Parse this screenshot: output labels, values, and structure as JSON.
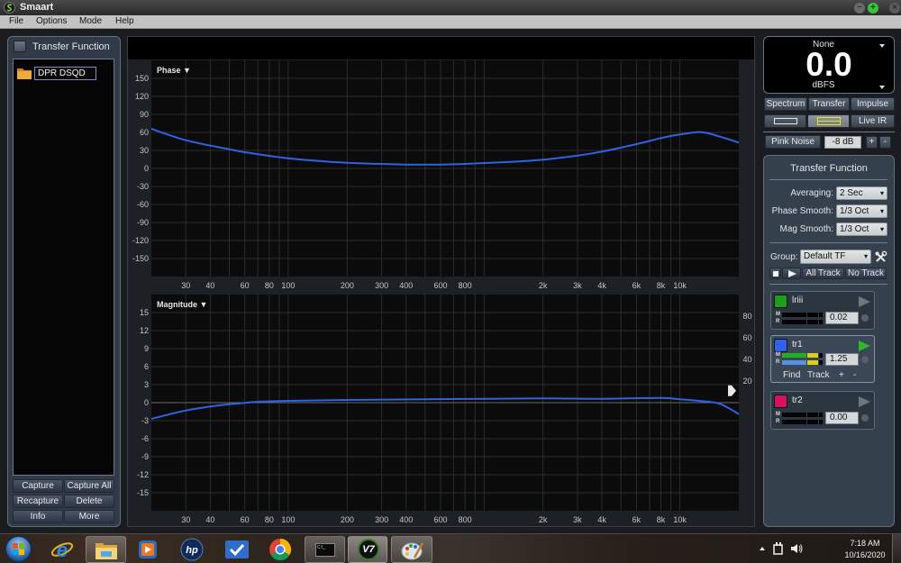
{
  "window": {
    "title": "Smaart",
    "controls": {
      "minimize": "−",
      "maximize": "+",
      "close": "×"
    }
  },
  "menu": [
    {
      "label": "File"
    },
    {
      "label": "Options"
    },
    {
      "label": "Mode"
    },
    {
      "label": "Help"
    }
  ],
  "left_panel": {
    "title": "Transfer Function",
    "items": [
      {
        "label": "DPR DSQD",
        "icon": "folder-icon"
      }
    ],
    "buttons": {
      "capture": "Capture",
      "capture_all": "Capture All",
      "recapture": "Recapture",
      "delete": "Delete",
      "info": "Info",
      "more": "More"
    }
  },
  "plots": {
    "phase_label": "Phase ▼",
    "magnitude_label": "Magnitude ▼"
  },
  "meter": {
    "source": "None",
    "value": "0.0",
    "unit": "dBFS"
  },
  "mode_tabs": [
    {
      "label": "Spectrum"
    },
    {
      "label": "Transfer"
    },
    {
      "label": "Impulse"
    }
  ],
  "view_buttons": {
    "single": "single-plot",
    "dual": "dual-plot",
    "live_ir": "Live IR",
    "active": "dual"
  },
  "generator": {
    "label": "Pink Noise",
    "level": "-8 dB",
    "plus": "+",
    "minus": "-"
  },
  "tf_panel": {
    "title": "Transfer Function",
    "averaging": {
      "label": "Averaging:",
      "value": "2 Sec"
    },
    "phase_smooth": {
      "label": "Phase Smooth:",
      "value": "1/3 Oct"
    },
    "mag_smooth": {
      "label": "Mag Smooth:",
      "value": "1/3 Oct"
    },
    "group": {
      "label": "Group:",
      "value": "Default TF"
    },
    "transport": {
      "all_track": "All Track",
      "no_track": "No Track"
    },
    "tracks": [
      {
        "name": "lriii",
        "color": "#1e9e1e",
        "delay": "0.02",
        "meter_m": 0.0,
        "meter_r": 0.0,
        "active": false,
        "playing": false
      },
      {
        "name": "tr1",
        "color": "#2f62e8",
        "delay": "1.25",
        "meter_m": 0.88,
        "meter_r": 0.88,
        "active": true,
        "playing": true,
        "actions": {
          "find": "Find",
          "track": "Track",
          "plus": "+",
          "minus": "-"
        }
      },
      {
        "name": "tr2",
        "color": "#d3145c",
        "delay": "0.00",
        "meter_m": 0.0,
        "meter_r": 0.0,
        "active": false,
        "playing": false
      }
    ],
    "meter_labels": {
      "m": "M",
      "r": "R"
    }
  },
  "taskbar": {
    "apps": [
      {
        "icon": "windows-start-icon"
      },
      {
        "icon": "internet-explorer-icon"
      },
      {
        "icon": "file-explorer-icon"
      },
      {
        "icon": "media-player-icon"
      },
      {
        "icon": "hp-icon"
      },
      {
        "icon": "checkmark-app-icon"
      },
      {
        "icon": "chrome-icon"
      },
      {
        "icon": "command-prompt-icon",
        "text": "C:\\_"
      },
      {
        "icon": "smaart-v7-icon",
        "text": "V7"
      },
      {
        "icon": "paint-icon"
      }
    ],
    "tray": {
      "time": "7:18 AM",
      "date": "10/16/2020"
    }
  },
  "chart_data": [
    {
      "type": "line",
      "title": "Phase",
      "xlabel": "",
      "ylabel": "",
      "xscale": "log",
      "xlim": [
        20,
        20000
      ],
      "ylim": [
        -180,
        180
      ],
      "grid": true,
      "x_gridlines": [
        30,
        40,
        50,
        60,
        70,
        80,
        90,
        100,
        200,
        300,
        400,
        500,
        600,
        700,
        800,
        900,
        1000,
        2000,
        3000,
        4000,
        5000,
        6000,
        7000,
        8000,
        9000,
        10000
      ],
      "x_ticks": [
        {
          "value": 30,
          "label": "30"
        },
        {
          "value": 40,
          "label": "40"
        },
        {
          "value": 60,
          "label": "60"
        },
        {
          "value": 80,
          "label": "80"
        },
        {
          "value": 100,
          "label": "100"
        },
        {
          "value": 200,
          "label": "200"
        },
        {
          "value": 300,
          "label": "300"
        },
        {
          "value": 400,
          "label": "400"
        },
        {
          "value": 600,
          "label": "600"
        },
        {
          "value": 800,
          "label": "800"
        },
        {
          "value": 2000,
          "label": "2k"
        },
        {
          "value": 3000,
          "label": "3k"
        },
        {
          "value": 4000,
          "label": "4k"
        },
        {
          "value": 6000,
          "label": "6k"
        },
        {
          "value": 8000,
          "label": "8k"
        },
        {
          "value": 10000,
          "label": "10k"
        }
      ],
      "y_ticks": [
        {
          "value": 150,
          "label": "150"
        },
        {
          "value": 120,
          "label": "120"
        },
        {
          "value": 90,
          "label": "90"
        },
        {
          "value": 60,
          "label": "60"
        },
        {
          "value": 30,
          "label": "30"
        },
        {
          "value": 0,
          "label": "0"
        },
        {
          "value": -30,
          "label": "-30"
        },
        {
          "value": -60,
          "label": "-60"
        },
        {
          "value": -90,
          "label": "-90"
        },
        {
          "value": -120,
          "label": "-120"
        },
        {
          "value": -150,
          "label": "-150"
        }
      ],
      "zero_line": false,
      "series": [
        {
          "color": "#2f62e6",
          "x": [
            20,
            25,
            30,
            40,
            50,
            60,
            80,
            100,
            150,
            200,
            300,
            400,
            600,
            800,
            1000,
            1500,
            2000,
            3000,
            4000,
            6000,
            8000,
            10000,
            12900,
            16000,
            20000
          ],
          "y": [
            66,
            55,
            47,
            38,
            32,
            27,
            21,
            17,
            12,
            9.5,
            7.5,
            6.5,
            6.5,
            7.5,
            9,
            11.5,
            14.5,
            21.5,
            28,
            40.5,
            50.5,
            56.5,
            60.5,
            53,
            43
          ]
        }
      ]
    },
    {
      "type": "line",
      "title": "Magnitude",
      "xlabel": "",
      "ylabel": "",
      "xscale": "log",
      "xlim": [
        20,
        20000
      ],
      "ylim": [
        -18,
        18
      ],
      "grid": true,
      "x_gridlines": [
        30,
        40,
        50,
        60,
        70,
        80,
        90,
        100,
        200,
        300,
        400,
        500,
        600,
        700,
        800,
        900,
        1000,
        2000,
        3000,
        4000,
        5000,
        6000,
        7000,
        8000,
        9000,
        10000
      ],
      "x_ticks": [
        {
          "value": 30,
          "label": "30"
        },
        {
          "value": 40,
          "label": "40"
        },
        {
          "value": 60,
          "label": "60"
        },
        {
          "value": 80,
          "label": "80"
        },
        {
          "value": 100,
          "label": "100"
        },
        {
          "value": 200,
          "label": "200"
        },
        {
          "value": 300,
          "label": "300"
        },
        {
          "value": 400,
          "label": "400"
        },
        {
          "value": 600,
          "label": "600"
        },
        {
          "value": 800,
          "label": "800"
        },
        {
          "value": 2000,
          "label": "2k"
        },
        {
          "value": 3000,
          "label": "3k"
        },
        {
          "value": 4000,
          "label": "4k"
        },
        {
          "value": 6000,
          "label": "6k"
        },
        {
          "value": 8000,
          "label": "8k"
        },
        {
          "value": 10000,
          "label": "10k"
        }
      ],
      "y_ticks": [
        {
          "value": 15,
          "label": "15"
        },
        {
          "value": 12,
          "label": "12"
        },
        {
          "value": 9,
          "label": "9"
        },
        {
          "value": 6,
          "label": "6"
        },
        {
          "value": 3,
          "label": "3"
        },
        {
          "value": 0,
          "label": "0"
        },
        {
          "value": -3,
          "label": "-3"
        },
        {
          "value": -6,
          "label": "-6"
        },
        {
          "value": -9,
          "label": "-9"
        },
        {
          "value": -12,
          "label": "-12"
        },
        {
          "value": -15,
          "label": "-15"
        }
      ],
      "zero_line": true,
      "secondary_axis": {
        "range": [
          0,
          100
        ],
        "ticks": [
          {
            "value": 80,
            "label": "80"
          },
          {
            "value": 60,
            "label": "60"
          },
          {
            "value": 40,
            "label": "40"
          },
          {
            "value": 20,
            "label": "20"
          }
        ],
        "threshold_marker": 11
      },
      "series": [
        {
          "color": "#2f62e6",
          "x": [
            20,
            25,
            30,
            40,
            50,
            60,
            70,
            100,
            200,
            500,
            1000,
            2000,
            4000,
            8000,
            10000,
            12500,
            16000,
            20000
          ],
          "y": [
            -2.7,
            -1.9,
            -1.3,
            -0.65,
            -0.25,
            -0.05,
            0.15,
            0.3,
            0.45,
            0.55,
            0.65,
            0.7,
            0.65,
            0.8,
            0.55,
            0.3,
            -0.2,
            -1.9
          ]
        }
      ]
    }
  ]
}
